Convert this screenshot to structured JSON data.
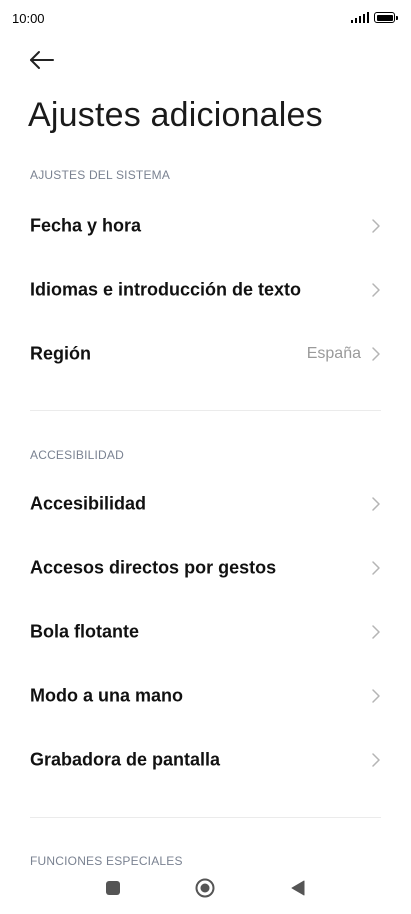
{
  "status_bar": {
    "time": "10:00"
  },
  "header": {
    "title": "Ajustes adicionales",
    "back_icon": "arrow-left-icon"
  },
  "sections": [
    {
      "header": "AJUSTES DEL SISTEMA",
      "items": [
        {
          "label": "Fecha y hora",
          "value": ""
        },
        {
          "label": "Idiomas e introducción de texto",
          "value": ""
        },
        {
          "label": "Región",
          "value": "España"
        }
      ]
    },
    {
      "header": "ACCESIBILIDAD",
      "items": [
        {
          "label": "Accesibilidad",
          "value": ""
        },
        {
          "label": "Accesos directos por gestos",
          "value": ""
        },
        {
          "label": "Bola flotante",
          "value": ""
        },
        {
          "label": "Modo a una mano",
          "value": ""
        },
        {
          "label": "Grabadora de pantalla",
          "value": ""
        }
      ]
    },
    {
      "header": "FUNCIONES ESPECIALES",
      "items": []
    }
  ],
  "colors": {
    "section_header": "#7a8291",
    "value_text": "#9a9a9a",
    "chevron": "#b5b5b5",
    "divider": "#ebebeb"
  },
  "nav_bar": {
    "icons": [
      "recents-square-icon",
      "home-circle-icon",
      "back-triangle-icon"
    ]
  }
}
